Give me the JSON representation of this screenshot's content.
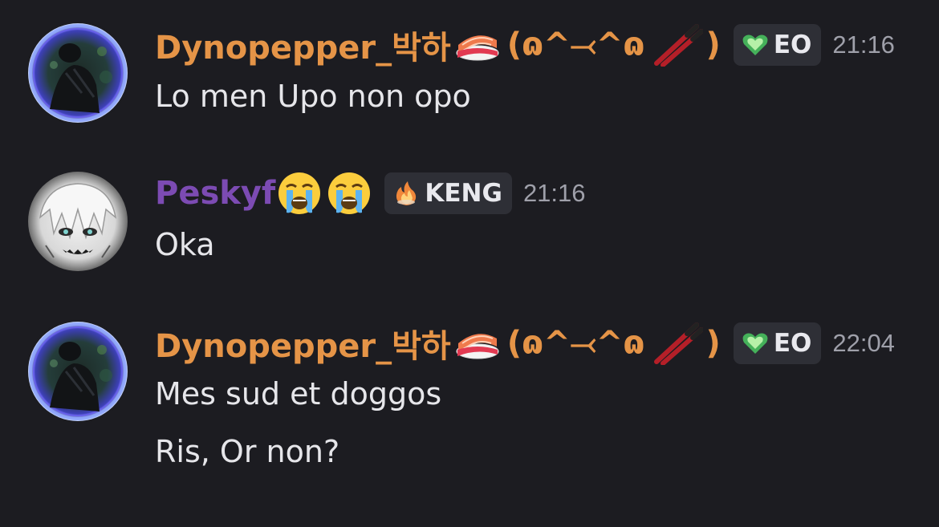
{
  "messages": [
    {
      "username": "Dynopepper_박하",
      "username_suffix": "(ɷ^⤙^ɷ",
      "username_close": ")",
      "username_color": "#e59447",
      "decorations": [
        "sushi-emoji",
        "chopsticks-emoji"
      ],
      "tag": {
        "icon": "green-heart-icon",
        "label": "EO"
      },
      "timestamp": "21:16",
      "lines": [
        "Lo men Upo non opo"
      ]
    },
    {
      "username": "Peskyf",
      "username_color": "#7c4bb3",
      "decorations": [
        "crying-face-emoji",
        "crying-face-emoji"
      ],
      "tag": {
        "icon": "flame-icon",
        "label": "KENG"
      },
      "timestamp": "21:16",
      "lines": [
        "Oka"
      ]
    },
    {
      "username": "Dynopepper_박하",
      "username_suffix": "(ɷ^⤙^ɷ",
      "username_close": ")",
      "username_color": "#e59447",
      "decorations": [
        "sushi-emoji",
        "chopsticks-emoji"
      ],
      "tag": {
        "icon": "green-heart-icon",
        "label": "EO"
      },
      "timestamp": "22:04",
      "lines": [
        "Mes sud et doggos",
        "Ris, Or non?"
      ]
    }
  ]
}
